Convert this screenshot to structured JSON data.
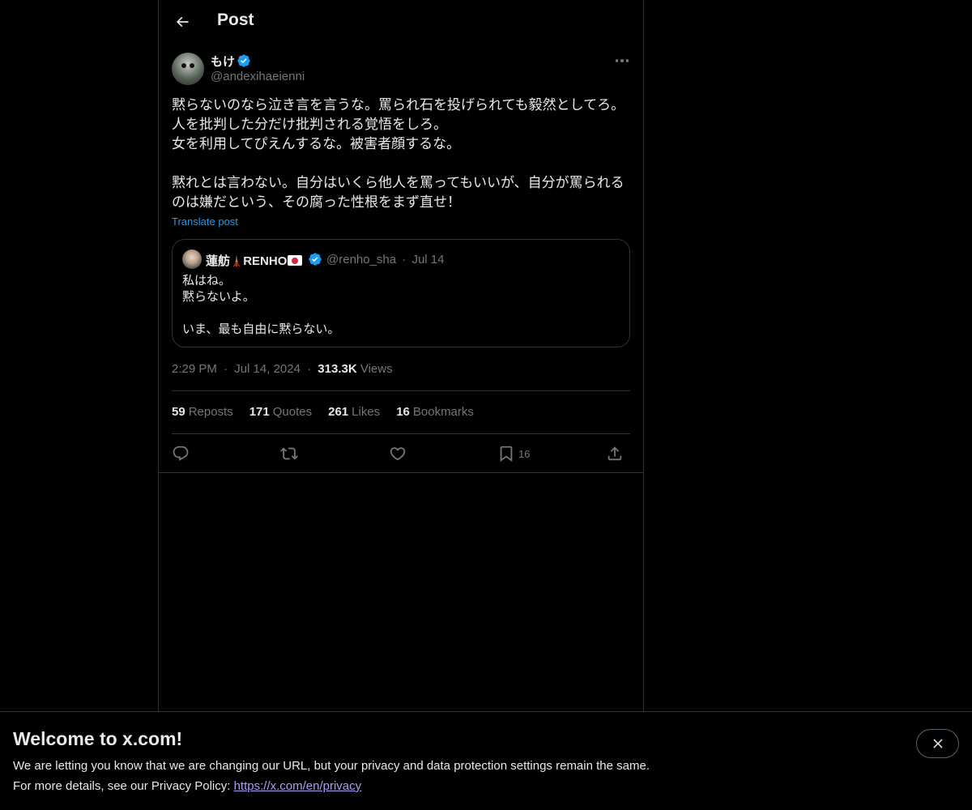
{
  "header": {
    "title": "Post",
    "back_icon": "arrow-left-icon"
  },
  "author": {
    "name": "もけ",
    "handle": "@andexihaeienni",
    "verified": true
  },
  "post": {
    "text": "黙らないのなら泣き言を言うな。罵られ石を投げられても毅然としてろ。\n人を批判した分だけ批判される覚悟をしろ。\n女を利用してぴえんするな。被害者顔するな。\n\n黙れとは言わない。自分はいくら他人を罵ってもいいが、自分が罵られるのは嫌だという、その腐った性根をまず直せ！",
    "translate_label": "Translate post"
  },
  "quote": {
    "name": "蓮舫",
    "name_suffix": "RENHO",
    "handle": "@renho_sha",
    "separator": "·",
    "date": "Jul 14",
    "text": "私はね。\n黙らないよ。\n\nいま、最も自由に黙らない。"
  },
  "meta": {
    "time": "2:29 PM",
    "separator": "·",
    "date": "Jul 14, 2024",
    "views_count": "313.3K",
    "views_label": "Views"
  },
  "stats": {
    "reposts": {
      "count": "59",
      "label": "Reposts"
    },
    "quotes": {
      "count": "171",
      "label": "Quotes"
    },
    "likes": {
      "count": "261",
      "label": "Likes"
    },
    "bookmarks": {
      "count": "16",
      "label": "Bookmarks"
    }
  },
  "actions": {
    "bookmark_count": "16"
  },
  "banner": {
    "title": "Welcome to x.com!",
    "line1": "We are letting you know that we are changing our URL, but your privacy and data protection settings remain the same.",
    "line2_prefix": "For more details, see our Privacy Policy: ",
    "link": "https://x.com/en/privacy"
  },
  "colors": {
    "background": "#000000",
    "text": "#e7e9ea",
    "muted": "#71767b",
    "accent": "#1d9bf0",
    "border": "#2f3336",
    "link": "#a99ff5"
  }
}
